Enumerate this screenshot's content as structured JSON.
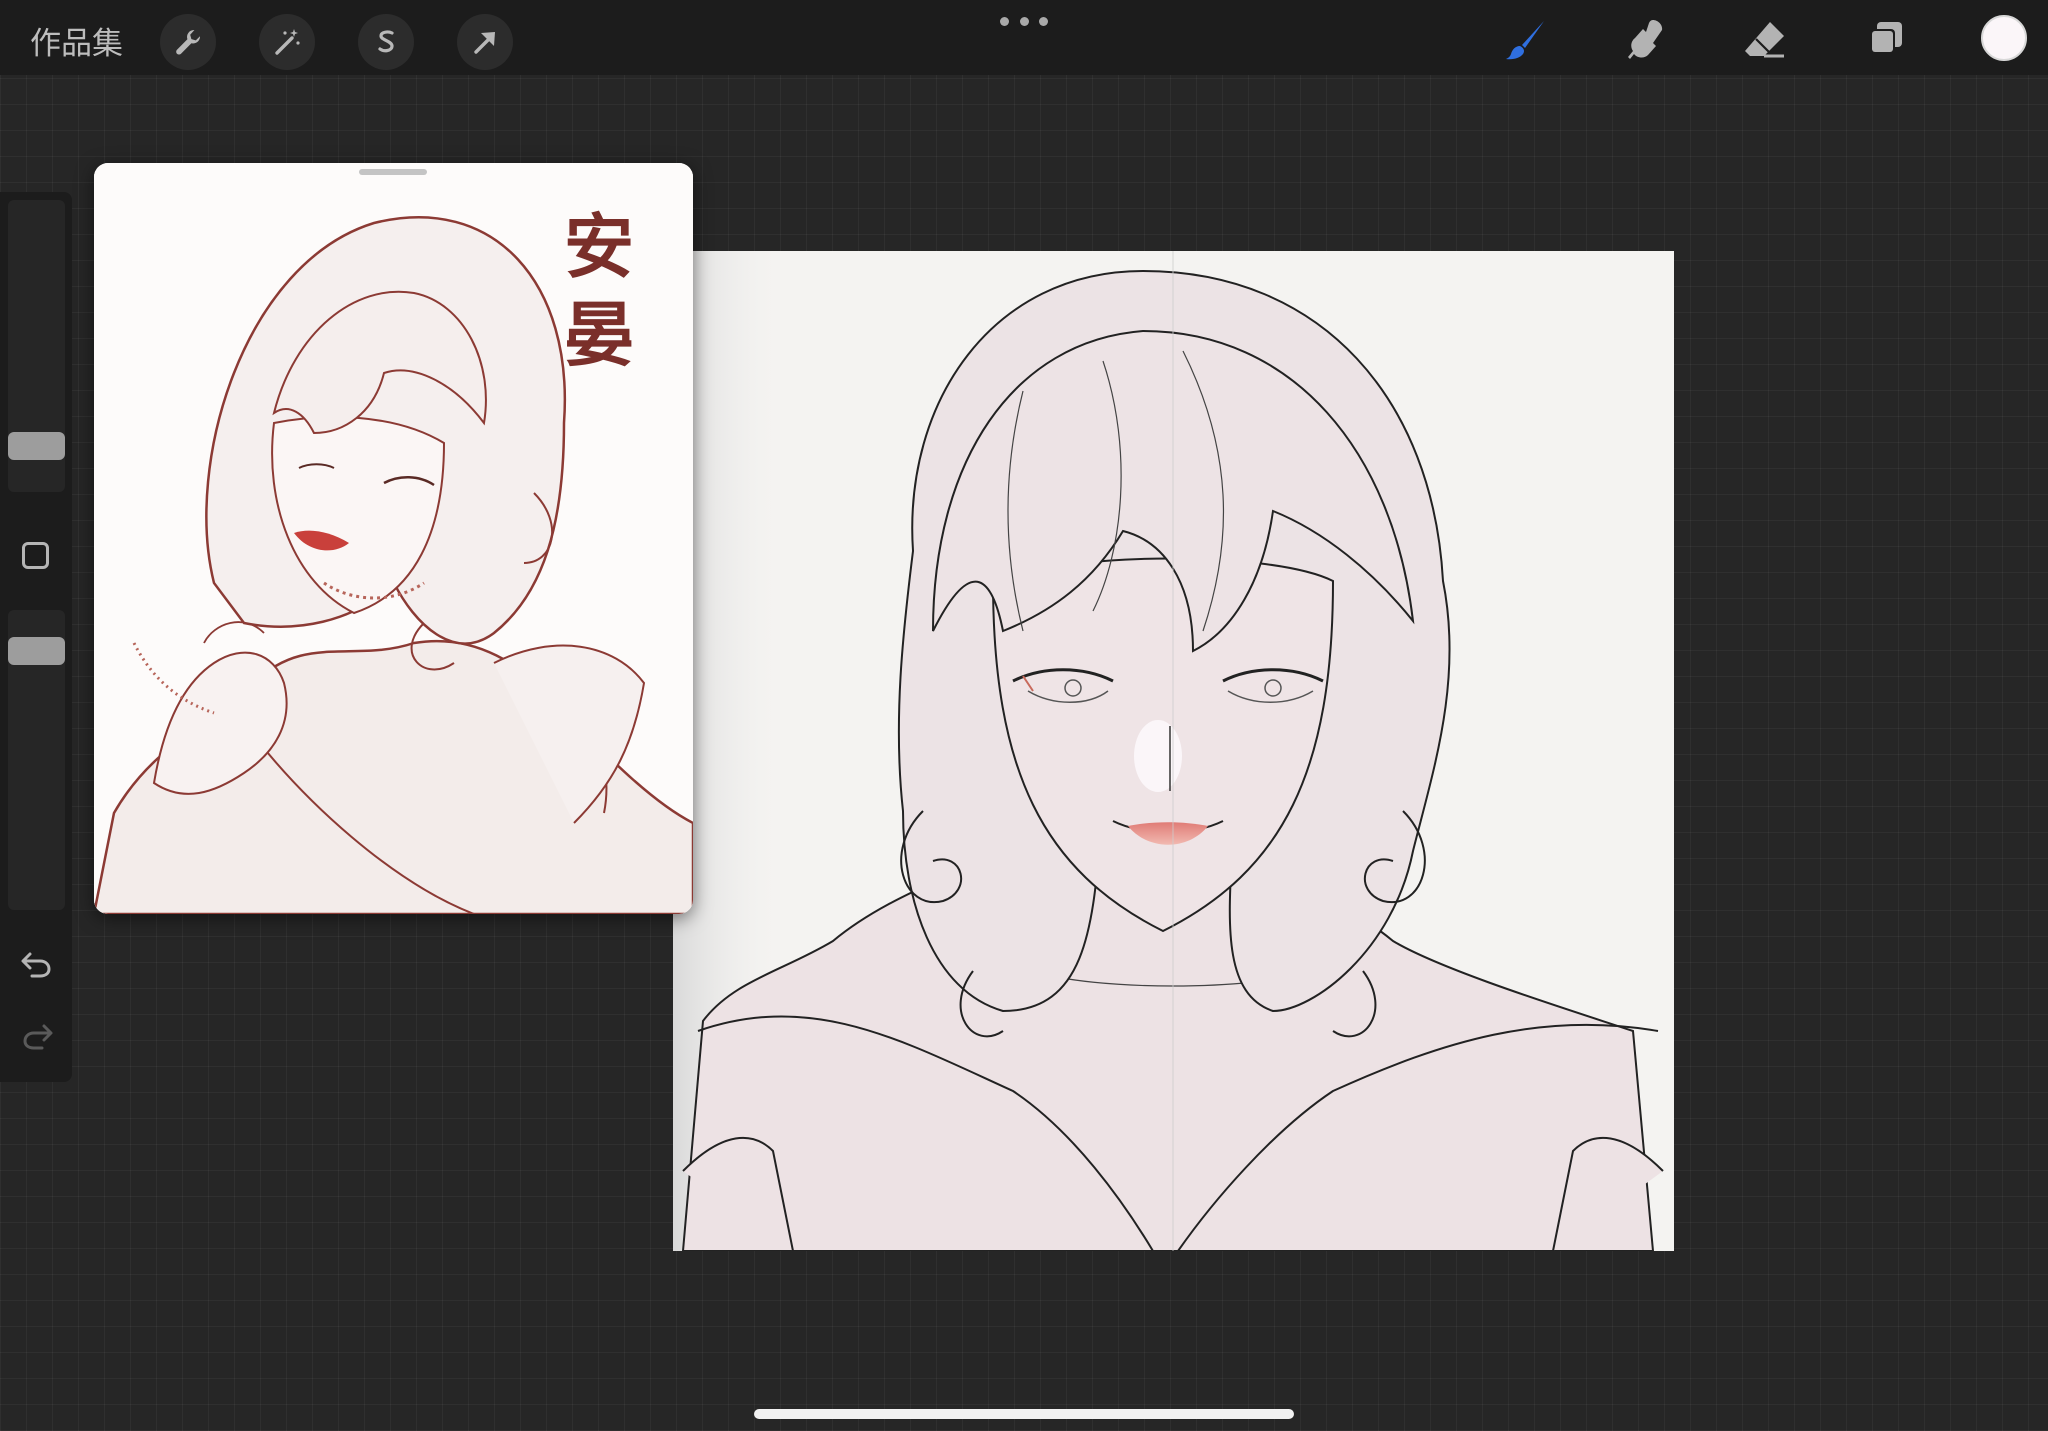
{
  "toolbar": {
    "gallery_label": "作品集",
    "left_tools": [
      {
        "name": "actions",
        "icon": "wrench-icon"
      },
      {
        "name": "adjustments",
        "icon": "magic-wand-icon"
      },
      {
        "name": "selection",
        "icon": "selection-s-icon"
      },
      {
        "name": "transform",
        "icon": "arrow-cursor-icon"
      }
    ],
    "more_icon": "more-dots-icon",
    "right_tools": [
      {
        "name": "brush",
        "icon": "brush-icon",
        "active": true
      },
      {
        "name": "smudge",
        "icon": "smudge-finger-icon"
      },
      {
        "name": "eraser",
        "icon": "eraser-icon"
      },
      {
        "name": "layers",
        "icon": "layers-icon"
      }
    ],
    "current_color": "#fbf6f9"
  },
  "sidebar": {
    "brush_size_level": 0.12,
    "opacity_level": 0.1,
    "icons": [
      "modify-square-icon",
      "undo-icon",
      "redo-icon"
    ]
  },
  "reference": {
    "calligraphy": "安晏"
  },
  "colors": {
    "active_tool": "#2f6fe0",
    "inactive_tool": "#b3b3b3",
    "canvas_bg": "#f4f3f1",
    "skin": "#ede2e4",
    "lips": "#d9857f",
    "sketch_ink": "#8c3a34"
  }
}
